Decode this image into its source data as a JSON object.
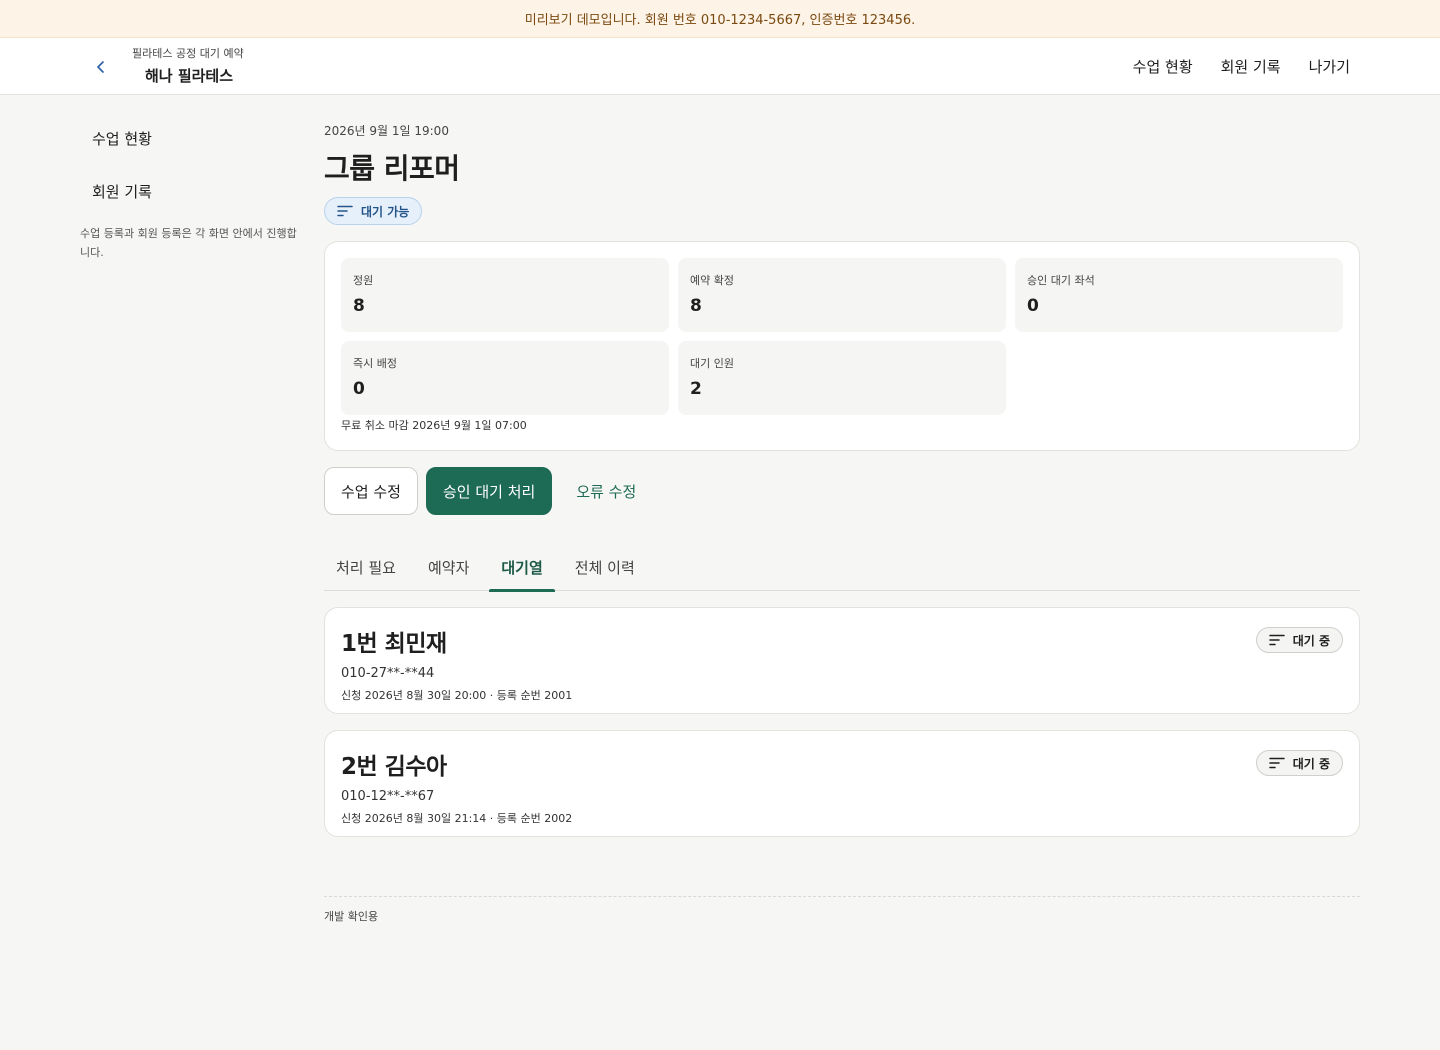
{
  "banner": {
    "text": "미리보기 데모입니다. 회원 번호 010-1234-5667, 인증번호 123456."
  },
  "header": {
    "subtitle": "필라테스 공정 대기 예약",
    "title": "해나 필라테스",
    "nav": [
      {
        "label": "수업 현황"
      },
      {
        "label": "회원 기록"
      },
      {
        "label": "나가기"
      }
    ]
  },
  "sidebar": {
    "items": [
      {
        "label": "수업 현황"
      },
      {
        "label": "회원 기록"
      }
    ],
    "note": "수업 등록과 회원 등록은 각 화면 안에서 진행합니다."
  },
  "class": {
    "datetime": "2026년 9월 1일 19:00",
    "title": "그룹 리포머",
    "status": "대기 가능"
  },
  "summary": {
    "stats": [
      {
        "label": "정원",
        "value": "8"
      },
      {
        "label": "예약 확정",
        "value": "8"
      },
      {
        "label": "승인 대기 좌석",
        "value": "0"
      },
      {
        "label": "즉시 배정",
        "value": "0"
      },
      {
        "label": "대기 인원",
        "value": "2"
      }
    ],
    "cancel_deadline": "무료 취소 마감 2026년 9월 1일 07:00"
  },
  "actions": {
    "edit": "수업 수정",
    "approve": "승인 대기 처리",
    "fix": "오류 수정"
  },
  "tabs": [
    {
      "label": "처리 필요"
    },
    {
      "label": "예약자"
    },
    {
      "label": "대기열"
    },
    {
      "label": "전체 이력"
    }
  ],
  "waitlist": [
    {
      "name": "1번 최민재",
      "phone": "010-27**-**44",
      "meta": "신청 2026년 8월 30일 20:00 · 등록 순번 2001",
      "status": "대기 중"
    },
    {
      "name": "2번 김수아",
      "phone": "010-12**-**67",
      "meta": "신청 2026년 8월 30일 21:14 · 등록 순번 2002",
      "status": "대기 중"
    }
  ],
  "footer": {
    "text": "개발 확인용"
  },
  "colors": {
    "accent": "#1d6a55",
    "banner_bg": "#fdf3e6",
    "pill_bg": "#e6f0fa"
  },
  "icons": {
    "back": "chevron-left-icon",
    "status": "filter-lines-icon"
  }
}
